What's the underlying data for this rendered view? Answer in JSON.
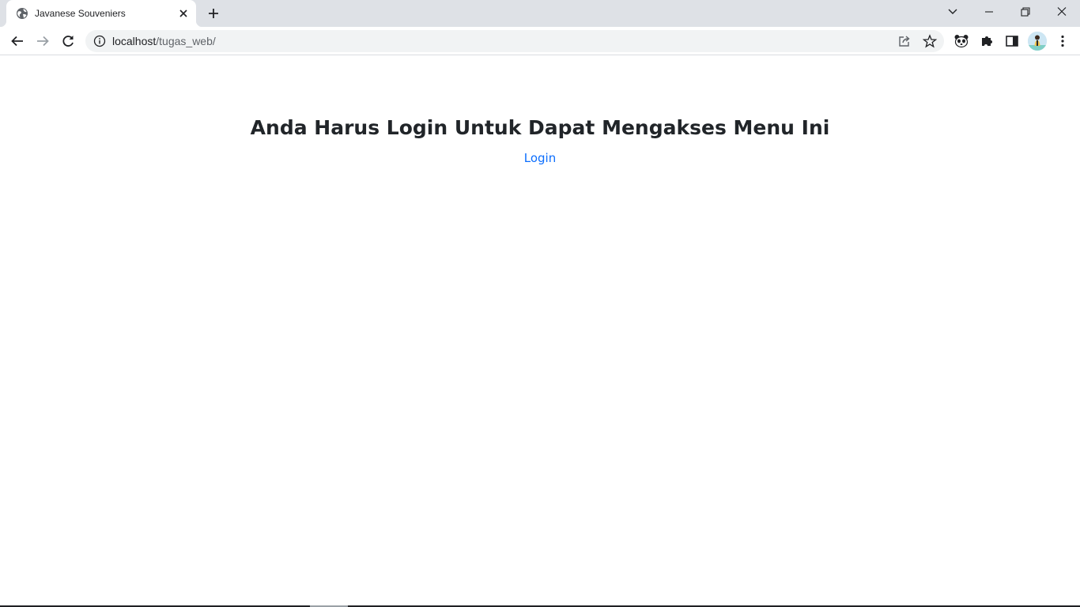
{
  "browser": {
    "tab": {
      "title": "Javanese Souveniers",
      "favicon": "globe-icon"
    },
    "toolbar": {
      "url_host": "localhost",
      "url_path": "/tugas_web/"
    },
    "icons": [
      "back-icon",
      "forward-icon",
      "reload-icon",
      "site-info-icon",
      "share-icon",
      "bookmark-star-icon",
      "panda-extension-icon",
      "puzzle-extension-icon",
      "side-panel-icon",
      "avatar",
      "kebab-menu-icon"
    ]
  },
  "page": {
    "heading": "Anda Harus Login Untuk Dapat Mengakses Menu Ini",
    "login_link": "Login"
  },
  "colors": {
    "tabstrip": "#dee1e6",
    "omnibox": "#f1f3f4",
    "heading_text": "#212529",
    "link": "#0d6efd"
  }
}
